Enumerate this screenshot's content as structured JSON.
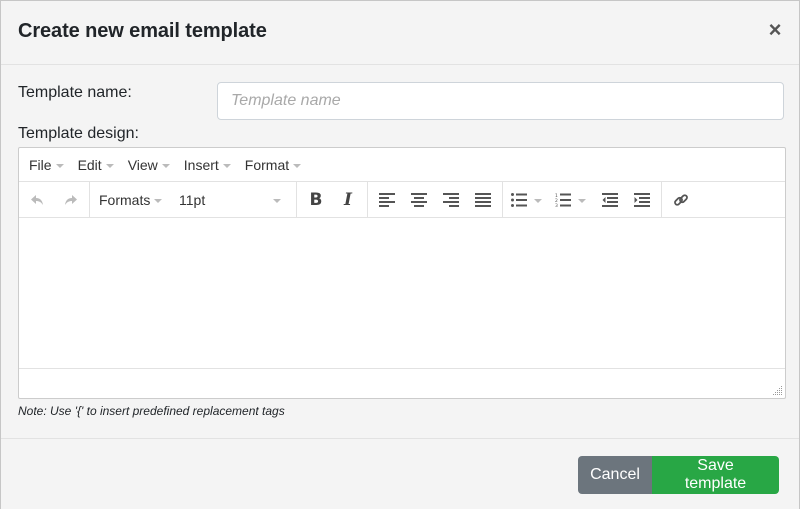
{
  "dialog": {
    "title": "Create new email template",
    "close_icon": "close-icon"
  },
  "form": {
    "name_label": "Template name:",
    "name_value": "",
    "name_placeholder": "Template name",
    "design_label": "Template design:",
    "note": "Note: Use '{' to insert predefined replacement tags"
  },
  "editor": {
    "menus": [
      "File",
      "Edit",
      "View",
      "Insert",
      "Format"
    ],
    "toolbar": {
      "undo_icon": "undo-icon",
      "redo_icon": "redo-icon",
      "formats_label": "Formats",
      "font_size": "11pt",
      "bold_label": "B",
      "italic_label": "I",
      "icons": [
        "align-left-icon",
        "align-center-icon",
        "align-right-icon",
        "align-justify-icon",
        "bullet-list-icon",
        "numbered-list-icon",
        "outdent-icon",
        "indent-icon",
        "link-icon"
      ]
    },
    "content": ""
  },
  "footer": {
    "cancel_label": "Cancel",
    "save_label": "Save template"
  },
  "colors": {
    "save": "#28a745",
    "cancel": "#6c757d",
    "background": "#f4f4f4"
  }
}
